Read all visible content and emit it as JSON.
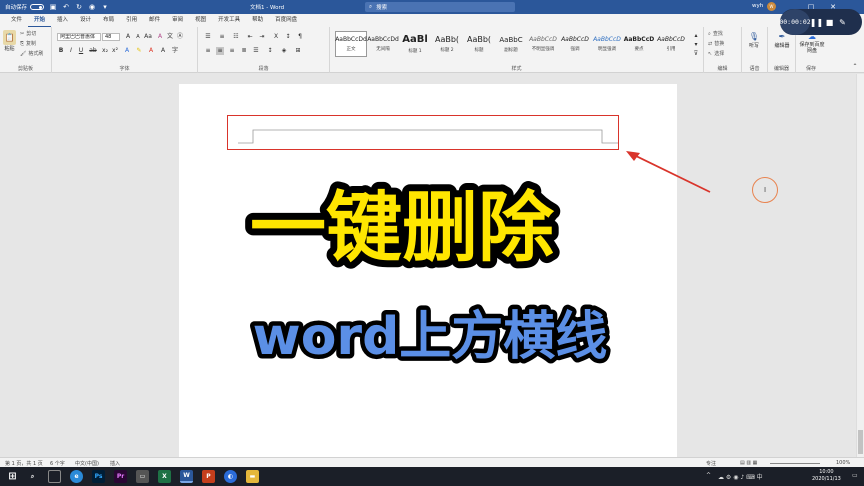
{
  "titlebar": {
    "autosave_label": "自动保存",
    "autosave_state": "off",
    "doc_title": "文档1 - Word",
    "search_placeholder": "搜索",
    "user_name": "wyh",
    "user_initial": "W"
  },
  "recorder": {
    "time": "00:00:02"
  },
  "tabs": [
    {
      "label": "文件"
    },
    {
      "label": "开始"
    },
    {
      "label": "插入"
    },
    {
      "label": "设计"
    },
    {
      "label": "布局"
    },
    {
      "label": "引用"
    },
    {
      "label": "邮件"
    },
    {
      "label": "审阅"
    },
    {
      "label": "视图"
    },
    {
      "label": "开发工具"
    },
    {
      "label": "帮助"
    },
    {
      "label": "百度网盘"
    }
  ],
  "ribbon": {
    "clipboard": {
      "paste": "粘贴",
      "cut": "剪切",
      "copy": "复制",
      "format_painter": "格式刷",
      "label": "剪贴板"
    },
    "font": {
      "font_name": "阿里巴巴普惠体",
      "font_size": "48",
      "label": "字体"
    },
    "paragraph": {
      "label": "段落"
    },
    "styles": {
      "label": "样式",
      "items": [
        {
          "sample": "AaBbCcDd",
          "name": "正文"
        },
        {
          "sample": "AaBbCcDd",
          "name": "无间隔"
        },
        {
          "sample": "AaBl",
          "name": "标题 1"
        },
        {
          "sample": "AaBb(",
          "name": "标题 2"
        },
        {
          "sample": "AaBb(",
          "name": "标题"
        },
        {
          "sample": "AaBbC",
          "name": "副标题"
        },
        {
          "sample": "AaBbCcD",
          "name": "不明显强调"
        },
        {
          "sample": "AaBbCcD",
          "name": "强调"
        },
        {
          "sample": "AaBbCcD",
          "name": "明显强调"
        },
        {
          "sample": "AaBbCcD",
          "name": "要点"
        },
        {
          "sample": "AaBbCcD",
          "name": "引用"
        }
      ]
    },
    "editing": {
      "find": "查找",
      "replace": "替换",
      "select": "选择",
      "label": "编辑"
    },
    "voice": {
      "dictate": "听写",
      "label": "语音"
    },
    "editor": {
      "editor": "编辑器",
      "label": "编辑器"
    },
    "save": {
      "button": "保存到百度网盘",
      "label": "保存"
    }
  },
  "document": {
    "headline": "一键删除",
    "subline": "word上方横线"
  },
  "statusbar": {
    "page": "第 1 页，共 1 页",
    "words": "6 个字",
    "language": "中文(中国)",
    "mode": "插入",
    "focus": "专注",
    "zoom": "100%"
  },
  "taskbar": {
    "time": "10:00",
    "date": "2020/11/13"
  },
  "colors": {
    "accent": "#2b579a",
    "highlight_box": "#d9342b",
    "headline_fill": "#ffe600",
    "subline_fill": "#5b8fe6"
  }
}
